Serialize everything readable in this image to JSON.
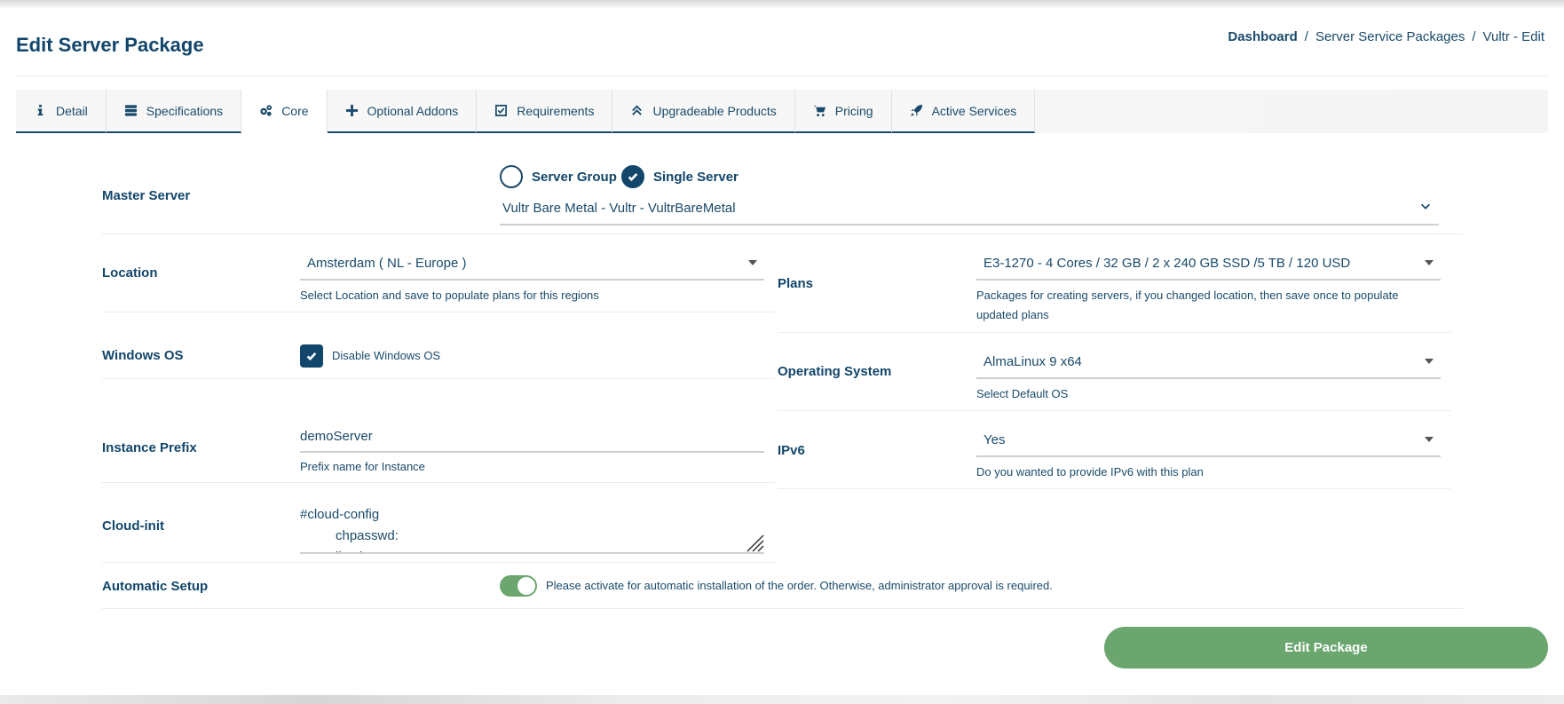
{
  "page": {
    "title": "Edit Server Package",
    "breadcrumb": [
      "Dashboard",
      "/",
      "Server Service Packages",
      "/",
      "Vultr - Edit"
    ]
  },
  "tabs": [
    {
      "label": "Detail",
      "icon": "info-icon",
      "active": false
    },
    {
      "label": "Specifications",
      "icon": "server-icon",
      "active": false
    },
    {
      "label": "Core",
      "icon": "gears-icon",
      "active": true
    },
    {
      "label": "Optional Addons",
      "icon": "plus-icon",
      "active": false
    },
    {
      "label": "Requirements",
      "icon": "check-square-icon",
      "active": false
    },
    {
      "label": "Upgradeable Products",
      "icon": "double-chevron-up-icon",
      "active": false
    },
    {
      "label": "Pricing",
      "icon": "cart-icon",
      "active": false
    },
    {
      "label": "Active Services",
      "icon": "rocket-icon",
      "active": false
    }
  ],
  "master_server": {
    "label": "Master Server",
    "options": [
      "Server Group",
      "Single Server"
    ],
    "selected": "Single Server",
    "server_value": "Vultr Bare Metal - Vultr - VultrBareMetal"
  },
  "location": {
    "label": "Location",
    "value": "Amsterdam ( NL - Europe )",
    "help": "Select Location and save to populate plans for this regions"
  },
  "plans": {
    "label": "Plans",
    "value": "E3-1270 - 4 Cores / 32 GB / 2 x 240 GB SSD /5 TB / 120 USD",
    "help": "Packages for creating servers, if you changed location, then save once to populate updated plans"
  },
  "windows_os": {
    "label": "Windows OS",
    "checkbox_label": "Disable Windows OS",
    "checked": true
  },
  "operating_system": {
    "label": "Operating System",
    "value": "AlmaLinux 9 x64",
    "help": "Select Default OS"
  },
  "instance_prefix": {
    "label": "Instance Prefix",
    "value": "demoServer",
    "help": "Prefix name for Instance"
  },
  "ipv6": {
    "label": "IPv6",
    "value": "Yes",
    "help": "Do you wanted to provide IPv6 with this plan"
  },
  "cloud_init": {
    "label": "Cloud-init",
    "line1": "#cloud-config",
    "line2": "chpasswd:",
    "line3": "list: |"
  },
  "automatic_setup": {
    "label": "Automatic Setup",
    "enabled": true,
    "text": "Please activate for automatic installation of the order. Otherwise, administrator approval is required."
  },
  "submit": {
    "label": "Edit Package"
  },
  "colors": {
    "primary": "#12466b",
    "accent_green": "#6aa66e"
  }
}
